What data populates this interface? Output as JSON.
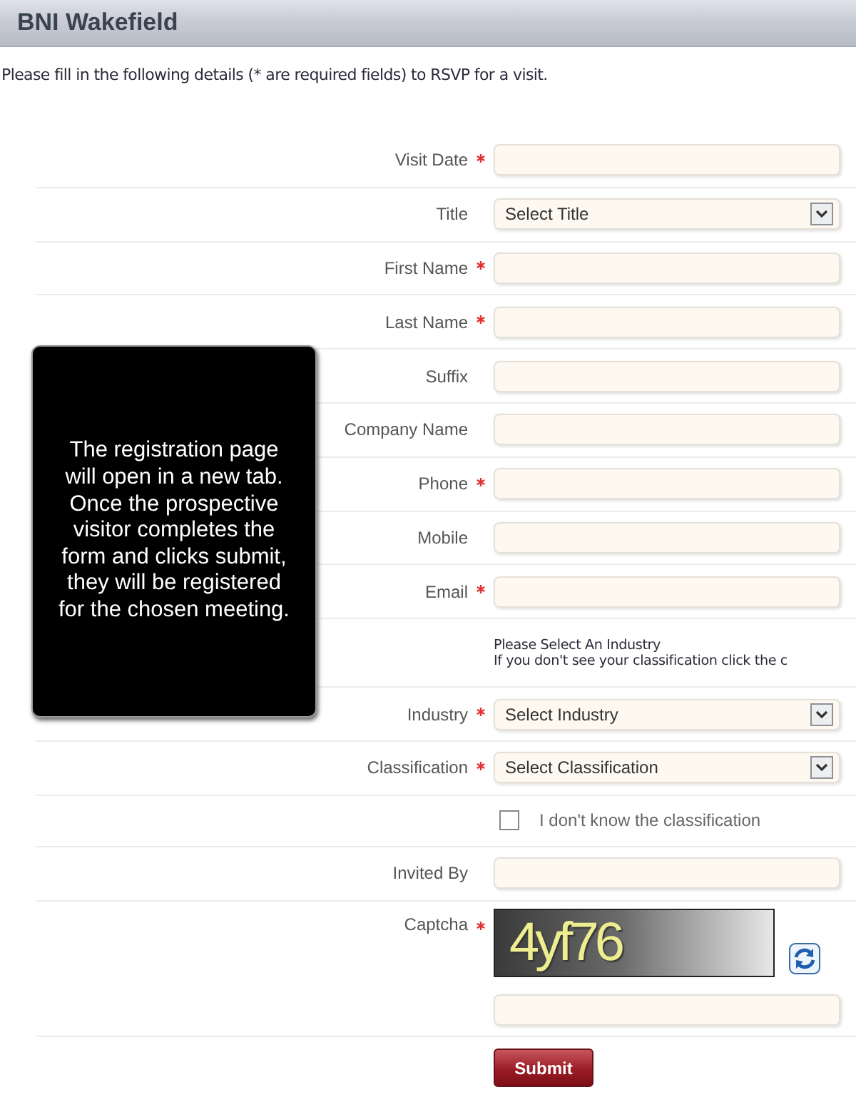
{
  "header": {
    "title": "BNI Wakefield"
  },
  "intro": "Please fill in the following details (* are required fields) to RSVP for a visit.",
  "fields": [
    {
      "kind": "text",
      "label": "Visit Date",
      "required": true
    },
    {
      "kind": "select",
      "label": "Title",
      "required": false,
      "value": "Select Title"
    },
    {
      "kind": "text",
      "label": "First Name",
      "required": true
    },
    {
      "kind": "text",
      "label": "Last Name",
      "required": true
    },
    {
      "kind": "text",
      "label": "Suffix",
      "required": false
    },
    {
      "kind": "text",
      "label": "Company Name",
      "required": false
    },
    {
      "kind": "text",
      "label": "Phone",
      "required": true
    },
    {
      "kind": "text",
      "label": "Mobile",
      "required": false
    },
    {
      "kind": "text",
      "label": "Email",
      "required": true
    },
    {
      "kind": "note",
      "lines": [
        "Please Select An Industry",
        "If you don't see your classification click the c"
      ]
    },
    {
      "kind": "select",
      "label": "Industry",
      "required": true,
      "value": "Select Industry"
    },
    {
      "kind": "select",
      "label": "Classification",
      "required": true,
      "value": "Select Classification"
    },
    {
      "kind": "checkbox",
      "label": "I don't know the classification",
      "checked": false
    },
    {
      "kind": "text",
      "label": "Invited By",
      "required": false
    },
    {
      "kind": "captcha",
      "label": "Captcha",
      "required": true,
      "code": "4yf76"
    },
    {
      "kind": "submit",
      "label": "Submit"
    }
  ],
  "tooltip": "The registration page will open in a new tab.  Once the prospective visitor completes the form and clicks submit, they will be registered for the chosen meeting."
}
